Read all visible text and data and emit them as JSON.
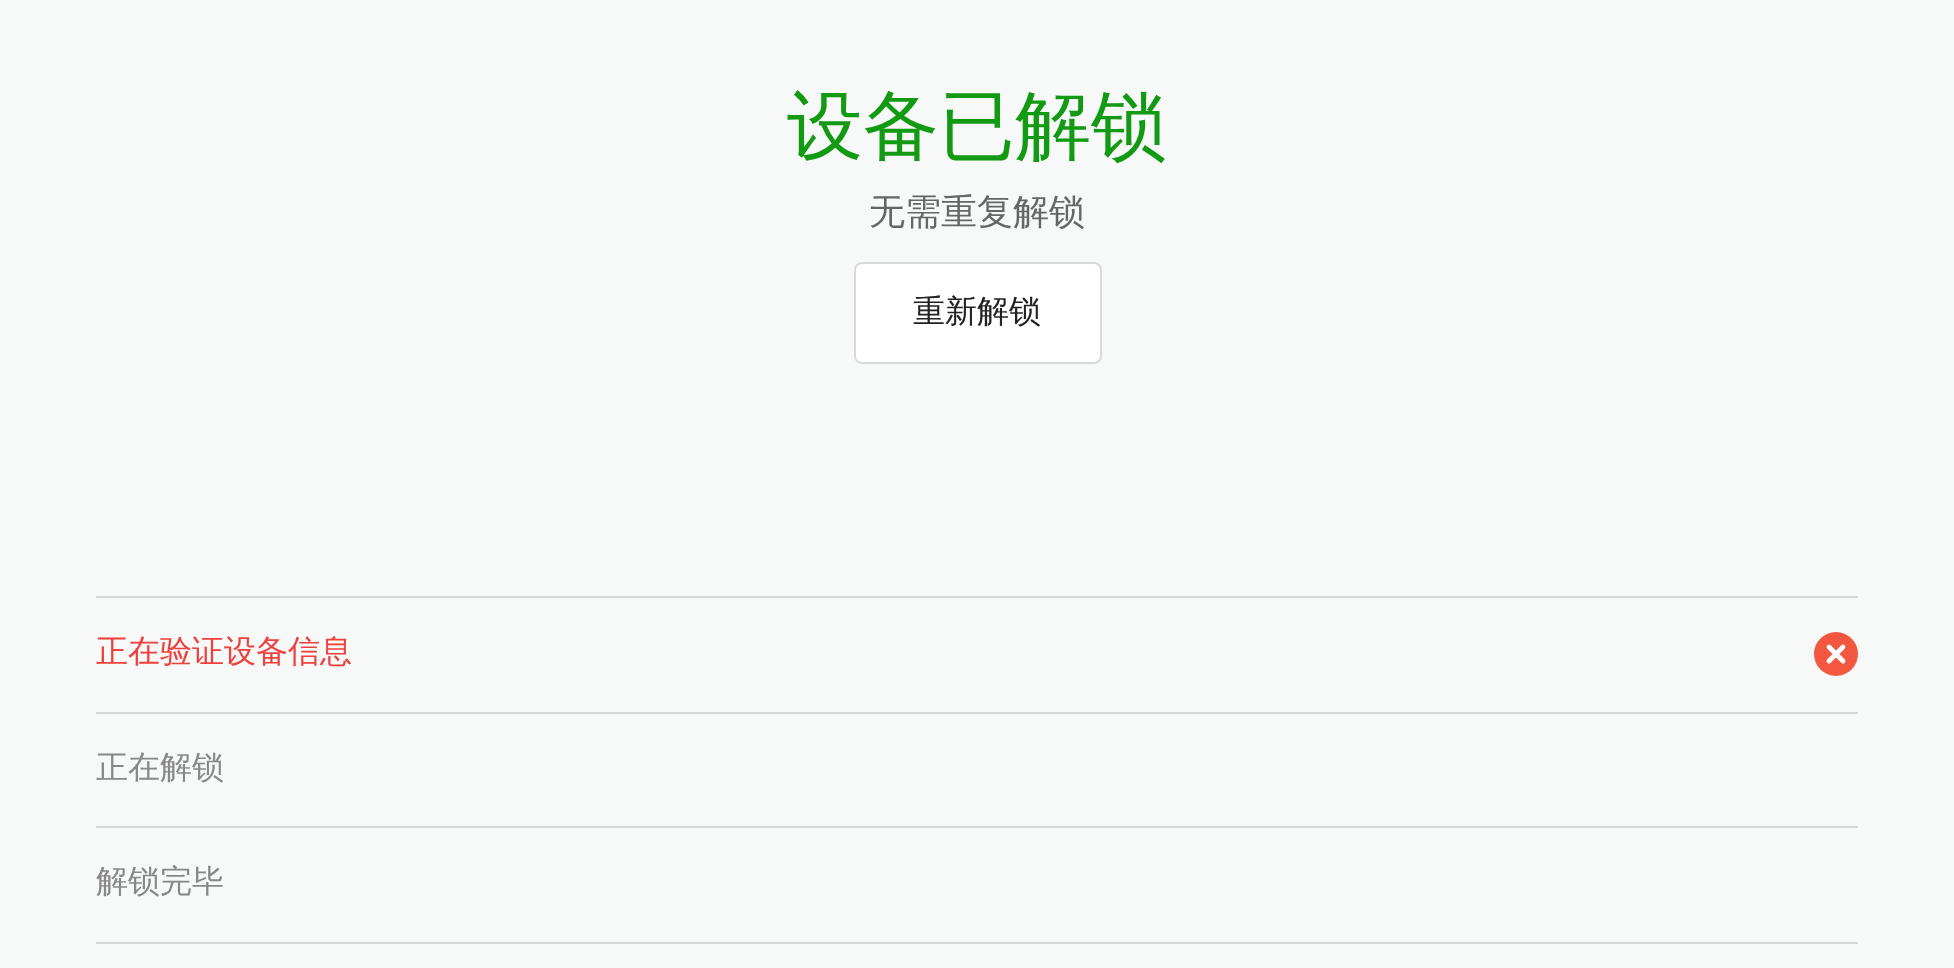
{
  "title": "设备已解锁",
  "subtitle": "无需重复解锁",
  "button": "重新解锁",
  "steps": [
    {
      "label": "正在验证设备信息",
      "kind": "error"
    },
    {
      "label": "正在解锁",
      "kind": "pending"
    },
    {
      "label": "解锁完毕",
      "kind": "pending"
    }
  ]
}
